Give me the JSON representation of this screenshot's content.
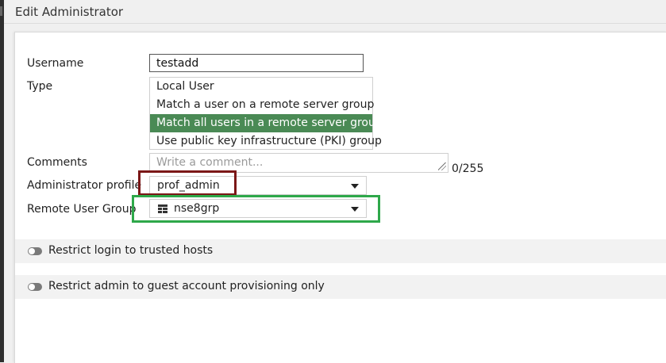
{
  "header": {
    "title": "Edit Administrator"
  },
  "form": {
    "username": {
      "label": "Username",
      "value": "testadd"
    },
    "type": {
      "label": "Type",
      "options": [
        "Local User",
        "Match a user on a remote server group",
        "Match all users in a remote server group",
        "Use public key infrastructure (PKI) group"
      ],
      "selected": "Match all users in a remote server group"
    },
    "comments": {
      "label": "Comments",
      "placeholder": "Write a comment...",
      "counter": "0/255"
    },
    "admin_profile": {
      "label": "Administrator profile",
      "value": "prof_admin"
    },
    "remote_user_group": {
      "label": "Remote User Group",
      "value": "nse8grp",
      "icon": "group-icon"
    }
  },
  "sections": {
    "trusted_hosts": {
      "label": "Restrict login to trusted hosts",
      "enabled": false
    },
    "guest_provisioning": {
      "label": "Restrict admin to guest account provisioning only",
      "enabled": false
    }
  },
  "colors": {
    "selected_option": "#4a8a55",
    "highlight_profile": "#7b1717",
    "highlight_group": "#2ea84a"
  }
}
